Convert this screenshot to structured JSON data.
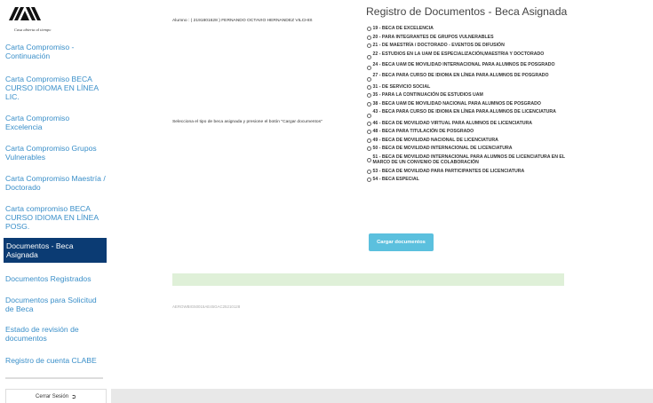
{
  "brand": {
    "logo_letters": "UAM",
    "tagline": "Casa abierta al tiempo"
  },
  "sidebar": {
    "items": [
      {
        "label": "Carta Compromiso - Continuación",
        "active": false
      },
      {
        "label": "Carta Compromiso BECA CURSO IDIOMA EN LÍNEA LIC.",
        "active": false
      },
      {
        "label": "Carta Compromiso Excelencia",
        "active": false
      },
      {
        "label": "Carta Compromiso Grupos Vulnerables",
        "active": false
      },
      {
        "label": "Carta Compromiso Maestría / Doctorado",
        "active": false
      },
      {
        "label": "Carta compromiso BECA CURSO IDIOMA EN LÍNEA POSG.",
        "active": false
      },
      {
        "label": "Documentos - Beca Asignada",
        "active": true
      },
      {
        "label": "Documentos Registrados",
        "active": false
      },
      {
        "label": "Documentos para Solicitud de Beca",
        "active": false
      },
      {
        "label": "Estado de revisión de documentos",
        "active": false
      },
      {
        "label": "Registro de cuenta CLABE",
        "active": false
      }
    ],
    "logout_label": "Cerrar Sesión",
    "logout_icon": "sign-out-icon"
  },
  "main": {
    "title": "Registro de Documentos - Beca Asignada",
    "student_line": "Alumno : ( 2191801628 ) FERNANDO OCTAVIO HERNANDEZ VILCHIS",
    "instructions": "Selecciona el tipo de beca asignada y presione el botón \"Cargar documentos\"",
    "options": [
      "19 - BECA DE EXCELENCIA",
      "20 - PARA INTEGRANTES DE GRUPOS VULNERABLES",
      "21 - DE MAESTRÍA / DOCTORADO - EVENTOS DE DIFUSIÓN",
      "22 - ESTUDIOS EN LA UAM DE ESPECIALIZACIÓN,MAESTRIA Y DOCTORADO",
      "24 - BECA UAM DE MOVILIDAD INTERNACIONAL PARA ALUMNOS DE POSGRADO",
      "27 - BECA PARA CURSO DE IDIOMA EN LÍNEA PARA ALUMNOS DE POSGRADO",
      "31 - DE SERVICIO SOCIAL",
      "35 - PARA LA CONTINUACIÓN DE ESTUDIOS UAM",
      "38 - BECA UAM DE MOVILIDAD NACIONAL PARA ALUMNOS DE POSGRADO",
      "43 - BECA PARA CURSO DE IDIOMA EN LÍNEA PARA ALUMNOS DE LICENCIATURA",
      "46 - BECA DE MOVILIDAD VIRTUAL PARA ALUMNOS DE LICENCIATURA",
      "48 - BECA PARA TITULACIÓN DE POSGRADO",
      "49 - BECA DE MOVILIDAD NACIONAL DE LICENCIATURA",
      "50 - BECA DE MOVILIDAD INTERNACIONAL DE LICENCIATURA",
      "51 - BECA DE MOVILIDAD INTERNACIONAL PARA ALUMNOS DE LICENCIATURA EN EL MARCO DE UN CONVENIO DE COLABORACIÓN",
      "53 - BECA DE MOVILIDAD PARA PARTICIPANTES DE LICENCIATURA",
      "54 - BECA ESPECIAL"
    ],
    "button_label": "Cargar documentos",
    "footer_hash": "AEROWBIG50015AE45GAC25210128"
  },
  "colors": {
    "link": "#3a8fc9",
    "active_bg": "#0b3b73",
    "button": "#5bc0de",
    "success_bar": "#dff0d8"
  }
}
